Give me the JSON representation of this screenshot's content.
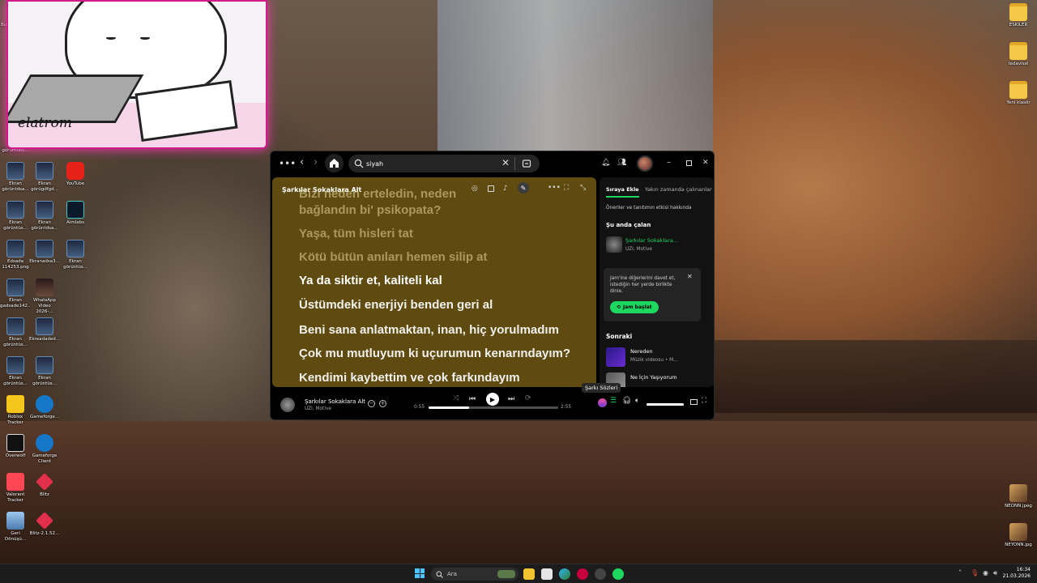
{
  "desktop": {
    "left_icons": [
      {
        "label": "Bu bilgisayar",
        "kind": "pc"
      },
      {
        "label": "",
        "kind": "hellokitty"
      },
      {
        "label": "Ekran görüntü...",
        "kind": "shot"
      },
      {
        "label": "Ekran görüntüsü...",
        "kind": "shot"
      },
      {
        "label": "Ekran görüntdsa...",
        "kind": "shot"
      },
      {
        "label": "Ekran görügdfgd...",
        "kind": "shot"
      },
      {
        "label": "YouTube",
        "kind": "youtube"
      },
      {
        "label": "Ekran görüntüs...",
        "kind": "shot"
      },
      {
        "label": "Ekran görüntdsa...",
        "kind": "shot"
      },
      {
        "label": "Aimlabs",
        "kind": "aimlabs"
      },
      {
        "label": "Edsada 114253.png",
        "kind": "shot"
      },
      {
        "label": "Ekranadsa3...",
        "kind": "shot"
      },
      {
        "label": "Ekran görüntüs...",
        "kind": "shot"
      },
      {
        "label": "Ekran gadsade142...",
        "kind": "shot"
      },
      {
        "label": "WhatsApp Video 2026-...",
        "kind": "video"
      },
      {
        "label": "Ekran görüntüs...",
        "kind": "shot"
      },
      {
        "label": "Ekreadaded...",
        "kind": "shot"
      },
      {
        "label": "Ekran görüntüs...",
        "kind": "shot"
      },
      {
        "label": "Ekran görüntüs...",
        "kind": "shot"
      },
      {
        "label": "Roblox Tracker",
        "kind": "roblox"
      },
      {
        "label": "Gameforge...",
        "kind": "gameforge"
      },
      {
        "label": "Overwolf",
        "kind": "overwolf"
      },
      {
        "label": "Gameforge Client",
        "kind": "gameforge"
      },
      {
        "label": "Valorant Tracker",
        "kind": "valorant"
      },
      {
        "label": "Blitz",
        "kind": "blitz"
      },
      {
        "label": "Geri Dönüşü...",
        "kind": "recycle"
      },
      {
        "label": "Blitz-2.1.52...",
        "kind": "blitz"
      }
    ],
    "right_icons": [
      {
        "label": "ESKİLER",
        "kind": "folder"
      },
      {
        "label": "tedavisel",
        "kind": "folder"
      },
      {
        "label": "Yeni klasör",
        "kind": "folder"
      },
      {
        "label": "NEONN.jpeg",
        "kind": "image"
      },
      {
        "label": "NEYONN.jpg",
        "kind": "image"
      }
    ],
    "sticker_text": "elatrom"
  },
  "spotify": {
    "search_value": "siyah",
    "now_playing_header": "Şarkılar Sokaklara Alt",
    "lyrics": [
      {
        "text": "Bizi neden erteledin, neden",
        "state": "past"
      },
      {
        "text": "bağlandın bi' psikopata?",
        "state": "past"
      },
      {
        "text": "Yaşa, tüm hisleri tat",
        "state": "past"
      },
      {
        "text": "Kötü bütün anıları hemen silip at",
        "state": "past"
      },
      {
        "text": "Ya da siktir et, kaliteli kal",
        "state": "active"
      },
      {
        "text": "Üstümdeki enerjiyi benden geri al",
        "state": "upcoming"
      },
      {
        "text": "Beni sana anlatmaktan, inan, hiç yorulmadım",
        "state": "upcoming"
      },
      {
        "text": "Çok mu mutluyum ki uçurumun kenarındayım?",
        "state": "upcoming"
      },
      {
        "text": "Kendimi kaybettim ve çok farkındayım",
        "state": "upcoming"
      }
    ],
    "queue": {
      "tab_active": "Sıraya Ekle",
      "tab_inactive": "Yakın zamanda çalınanlar",
      "info_link": "Öneriler ve tanıtımın etkisi hakkında",
      "now_playing_label": "Şu anda çalan",
      "current": {
        "title": "Şarkılar Sokaklara...",
        "artist": "UZI, Motive"
      },
      "jam_text": "Jam'ine diğerlerini davet et, istediğin her yerde birlikte dinle.",
      "jam_button": "Jam başlat",
      "next_label": "Sonraki",
      "next_items": [
        {
          "title": "Nereden",
          "subtitle": "Müzik videosu • M..."
        },
        {
          "title": "Ne İçin Yaşıyorum",
          "subtitle": ""
        }
      ]
    },
    "player": {
      "title": "Şarkılar Sokaklara Alt",
      "artist": "UZI, Motive",
      "elapsed": "0:55",
      "duration": "2:55",
      "progress_fraction": 0.31,
      "volume_fraction": 1.0,
      "tooltip": "Şarkı Sözleri"
    },
    "colors": {
      "accent": "#1ed760",
      "lyrics_bg": "#5f4b10"
    }
  },
  "taskbar": {
    "search_placeholder": "Ara",
    "time": "16:34",
    "date": "21.03.2026"
  }
}
